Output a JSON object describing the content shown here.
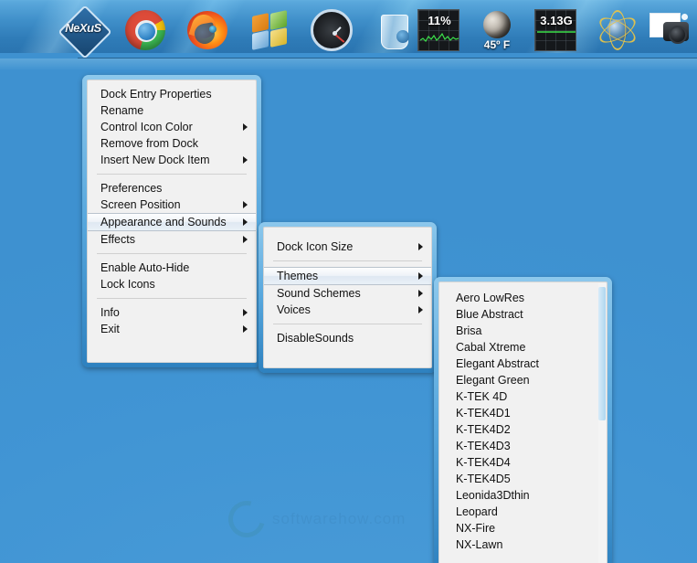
{
  "desktop": {
    "background_color": "#4195d4",
    "watermark_text": "softwarehow.com",
    "watermark_icon": "leaf-swirl-logo"
  },
  "dock": {
    "name": "Winstep Nexus Dock",
    "items": [
      {
        "icon": "nexus-logo-icon",
        "label": "Nexus",
        "value": "NeXuS"
      },
      {
        "icon": "google-chrome-icon",
        "label": "Google Chrome",
        "value": ""
      },
      {
        "icon": "mozilla-firefox-icon",
        "label": "Mozilla Firefox",
        "value": ""
      },
      {
        "icon": "windows-flag-icon",
        "label": "Start",
        "value": ""
      },
      {
        "icon": "clock-gauge-icon",
        "label": "Clock",
        "value": ""
      },
      {
        "icon": "recycle-bin-icon",
        "label": "Recycle Bin",
        "value": ""
      },
      {
        "icon": "cpu-meter-icon",
        "label": "CPU Meter",
        "value": "11%"
      },
      {
        "icon": "moon-weather-icon",
        "label": "Weather",
        "value": "45º F"
      },
      {
        "icon": "memory-meter-icon",
        "label": "Memory Meter",
        "value": "3.13G"
      },
      {
        "icon": "network-globe-icon",
        "label": "Network",
        "value": ""
      },
      {
        "icon": "camera-photo-icon",
        "label": "Photos",
        "value": ""
      }
    ]
  },
  "menu_dock": {
    "name": "dock-context-menu",
    "items": [
      {
        "label": "Dock Entry Properties",
        "submenu": false,
        "selected": false
      },
      {
        "label": "Rename",
        "submenu": false,
        "selected": false
      },
      {
        "label": "Control Icon Color",
        "submenu": true,
        "selected": false
      },
      {
        "label": "Remove from Dock",
        "submenu": false,
        "selected": false
      },
      {
        "label": "Insert New Dock Item",
        "submenu": true,
        "selected": false
      },
      {
        "separator": true
      },
      {
        "label": "Preferences",
        "submenu": false,
        "selected": false
      },
      {
        "label": "Screen Position",
        "submenu": true,
        "selected": false
      },
      {
        "label": "Appearance and Sounds",
        "submenu": true,
        "selected": true
      },
      {
        "label": "Effects",
        "submenu": true,
        "selected": false
      },
      {
        "separator": true
      },
      {
        "label": "Enable Auto-Hide",
        "submenu": false,
        "selected": false
      },
      {
        "label": "Lock Icons",
        "submenu": false,
        "selected": false
      },
      {
        "separator": true
      },
      {
        "label": "Info",
        "submenu": true,
        "selected": false
      },
      {
        "label": "Exit",
        "submenu": true,
        "selected": false
      }
    ]
  },
  "menu_appearance": {
    "name": "appearance-and-sounds-submenu",
    "items": [
      {
        "label": "Dock Icon Size",
        "submenu": true,
        "selected": false
      },
      {
        "separator": true
      },
      {
        "label": "Themes",
        "submenu": true,
        "selected": true
      },
      {
        "label": "Sound Schemes",
        "submenu": true,
        "selected": false
      },
      {
        "label": "Voices",
        "submenu": true,
        "selected": false
      },
      {
        "separator": true
      },
      {
        "label": "DisableSounds",
        "submenu": false,
        "selected": false
      }
    ]
  },
  "menu_themes": {
    "name": "themes-submenu",
    "scrollbar": {
      "visible": true,
      "thumb_position": "top"
    },
    "items": [
      {
        "label": "Aero LowRes",
        "selected": false
      },
      {
        "label": "Blue Abstract",
        "selected": false
      },
      {
        "label": "Brisa",
        "selected": false
      },
      {
        "label": "Cabal Xtreme",
        "selected": false
      },
      {
        "label": "Elegant Abstract",
        "selected": false
      },
      {
        "label": "Elegant Green",
        "selected": false
      },
      {
        "label": "K-TEK 4D",
        "selected": false
      },
      {
        "label": "K-TEK4D1",
        "selected": false
      },
      {
        "label": "K-TEK4D2",
        "selected": false
      },
      {
        "label": "K-TEK4D3",
        "selected": false
      },
      {
        "label": "K-TEK4D4",
        "selected": false
      },
      {
        "label": "K-TEK4D5",
        "selected": false
      },
      {
        "label": "Leonida3Dthin",
        "selected": false
      },
      {
        "label": "Leopard",
        "selected": false
      },
      {
        "label": "NX-Fire",
        "selected": false
      },
      {
        "label": "NX-Lawn",
        "selected": false
      }
    ]
  }
}
